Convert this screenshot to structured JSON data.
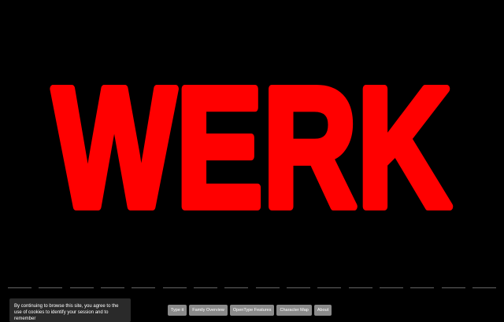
{
  "hero": {
    "word": "WERK",
    "color": "#ff0000",
    "background": "#000000"
  },
  "cookie_notice": {
    "text": "By continuing to browse this site, you agree to the use of cookies to identify your session and to remember"
  },
  "nav": {
    "items": [
      {
        "label": "Type it"
      },
      {
        "label": "Family Overview"
      },
      {
        "label": "OpenType Features"
      },
      {
        "label": "Character Map"
      },
      {
        "label": "About"
      }
    ]
  }
}
